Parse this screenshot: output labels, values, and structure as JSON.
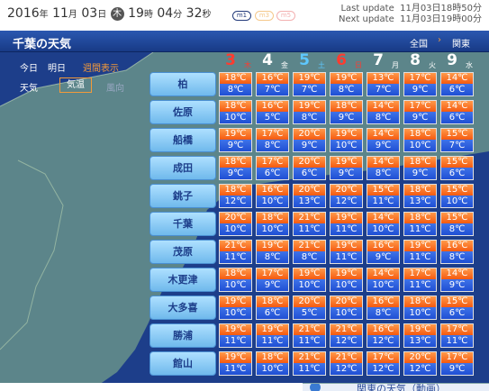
{
  "top": {
    "year": "2016",
    "year_unit": "年",
    "month": "11",
    "month_unit": "月",
    "day": "03",
    "day_unit": "日",
    "weekday": "木",
    "hour": "19",
    "hour_unit": "時",
    "minute": "04",
    "minute_unit": "分",
    "second": "32",
    "second_unit": "秒",
    "modes": [
      "m1",
      "m3",
      "m5"
    ],
    "last_update_label": "Last update",
    "last_update": "11月03日18時50分",
    "next_update_label": "Next update",
    "next_update": "11月03日19時00分"
  },
  "header": {
    "title": "千葉の天気",
    "national": "全国",
    "separator": "›",
    "kanto": "関東"
  },
  "controls": {
    "today": "今日",
    "tomorrow": "明日",
    "weekly": "週間表示",
    "weather": "天気",
    "temperature": "気温",
    "wind": "風向"
  },
  "dates": [
    {
      "day": "3",
      "weekday": "木",
      "color": "#ff3b2f"
    },
    {
      "day": "4",
      "weekday": "金",
      "color": "#ffffff"
    },
    {
      "day": "5",
      "weekday": "土",
      "color": "#5ec8ff"
    },
    {
      "day": "6",
      "weekday": "日",
      "color": "#ff3b2f"
    },
    {
      "day": "7",
      "weekday": "月",
      "color": "#ffffff"
    },
    {
      "day": "8",
      "weekday": "火",
      "color": "#ffffff"
    },
    {
      "day": "9",
      "weekday": "水",
      "color": "#ffffff"
    }
  ],
  "cities": [
    {
      "name": "柏",
      "highs": [
        "18℃",
        "16℃",
        "19℃",
        "19℃",
        "13℃",
        "17℃",
        "14℃"
      ],
      "lows": [
        "8℃",
        "7℃",
        "7℃",
        "8℃",
        "7℃",
        "9℃",
        "6℃"
      ]
    },
    {
      "name": "佐原",
      "highs": [
        "18℃",
        "16℃",
        "19℃",
        "18℃",
        "14℃",
        "17℃",
        "14℃"
      ],
      "lows": [
        "10℃",
        "5℃",
        "8℃",
        "9℃",
        "8℃",
        "9℃",
        "6℃"
      ]
    },
    {
      "name": "船橋",
      "highs": [
        "19℃",
        "17℃",
        "20℃",
        "19℃",
        "14℃",
        "18℃",
        "15℃"
      ],
      "lows": [
        "9℃",
        "8℃",
        "9℃",
        "10℃",
        "9℃",
        "10℃",
        "7℃"
      ]
    },
    {
      "name": "成田",
      "highs": [
        "18℃",
        "17℃",
        "20℃",
        "19℃",
        "14℃",
        "18℃",
        "15℃"
      ],
      "lows": [
        "9℃",
        "6℃",
        "6℃",
        "9℃",
        "8℃",
        "9℃",
        "6℃"
      ]
    },
    {
      "name": "銚子",
      "highs": [
        "18℃",
        "16℃",
        "20℃",
        "20℃",
        "15℃",
        "18℃",
        "15℃"
      ],
      "lows": [
        "12℃",
        "10℃",
        "13℃",
        "12℃",
        "11℃",
        "13℃",
        "10℃"
      ]
    },
    {
      "name": "千葉",
      "highs": [
        "20℃",
        "18℃",
        "21℃",
        "19℃",
        "14℃",
        "18℃",
        "15℃"
      ],
      "lows": [
        "10℃",
        "10℃",
        "11℃",
        "11℃",
        "10℃",
        "11℃",
        "8℃"
      ]
    },
    {
      "name": "茂原",
      "highs": [
        "21℃",
        "19℃",
        "21℃",
        "19℃",
        "16℃",
        "19℃",
        "16℃"
      ],
      "lows": [
        "11℃",
        "8℃",
        "8℃",
        "11℃",
        "9℃",
        "11℃",
        "8℃"
      ]
    },
    {
      "name": "木更津",
      "highs": [
        "18℃",
        "17℃",
        "19℃",
        "19℃",
        "14℃",
        "17℃",
        "14℃"
      ],
      "lows": [
        "10℃",
        "9℃",
        "10℃",
        "10℃",
        "10℃",
        "11℃",
        "9℃"
      ]
    },
    {
      "name": "大多喜",
      "highs": [
        "19℃",
        "18℃",
        "20℃",
        "20℃",
        "16℃",
        "18℃",
        "15℃"
      ],
      "lows": [
        "10℃",
        "6℃",
        "5℃",
        "10℃",
        "8℃",
        "10℃",
        "6℃"
      ]
    },
    {
      "name": "勝浦",
      "highs": [
        "19℃",
        "19℃",
        "21℃",
        "21℃",
        "16℃",
        "19℃",
        "17℃"
      ],
      "lows": [
        "11℃",
        "11℃",
        "11℃",
        "12℃",
        "12℃",
        "13℃",
        "11℃"
      ]
    },
    {
      "name": "館山",
      "highs": [
        "19℃",
        "18℃",
        "21℃",
        "21℃",
        "17℃",
        "20℃",
        "17℃"
      ],
      "lows": [
        "11℃",
        "10℃",
        "11℃",
        "12℃",
        "12℃",
        "12℃",
        "9℃"
      ]
    }
  ],
  "bottom_link": "関東の天気（動画）",
  "colors": {
    "panel_bg": "#1d3e8a",
    "high_temp": "#f55a10",
    "low_temp": "#1f4fd4",
    "accent": "#f39a3a",
    "map_land": "#8fbf8a"
  }
}
